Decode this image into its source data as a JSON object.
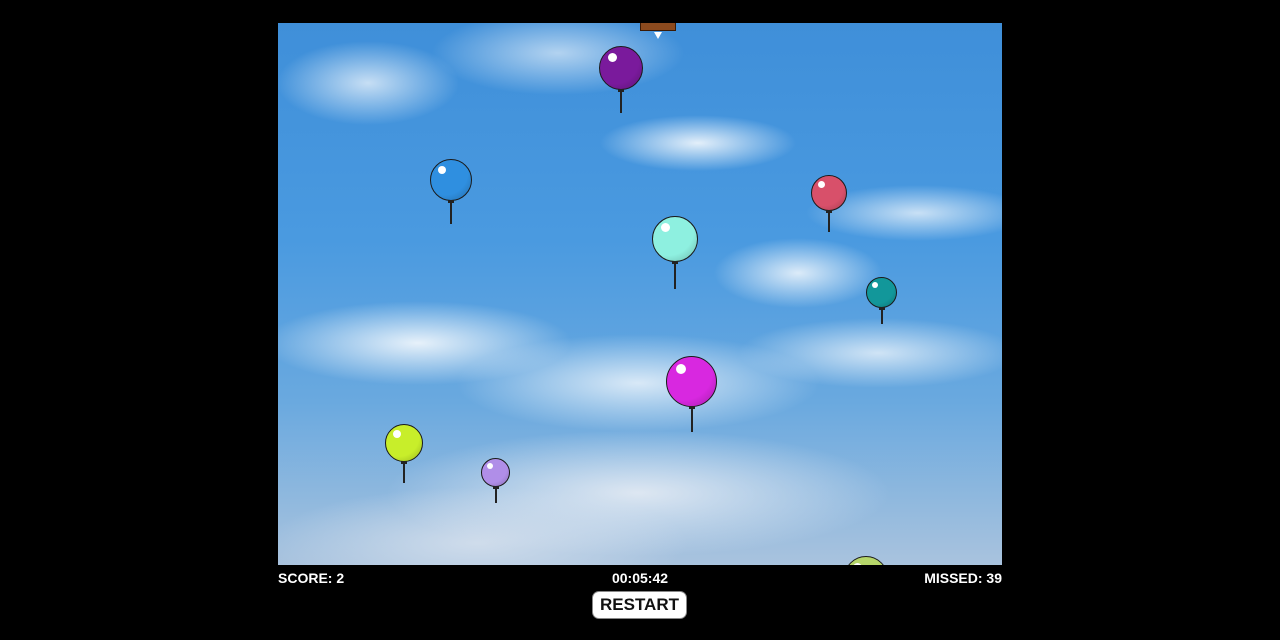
{
  "hud": {
    "score_text": "SCORE: 2",
    "timer_text": "00:05:42",
    "missed_text": "MISSED: 39"
  },
  "controls": {
    "restart_label": "RESTART"
  },
  "balloons": [
    {
      "color": "#7a1a9c",
      "name": "balloon-purple"
    },
    {
      "color": "#2f8fe0",
      "name": "balloon-blue"
    },
    {
      "color": "#d8506a",
      "name": "balloon-red"
    },
    {
      "color": "#8ef0e0",
      "name": "balloon-mint"
    },
    {
      "color": "#12979a",
      "name": "balloon-teal"
    },
    {
      "color": "#d828e0",
      "name": "balloon-magenta"
    },
    {
      "color": "#c8ee2a",
      "name": "balloon-lime"
    },
    {
      "color": "#b08ee8",
      "name": "balloon-lavender"
    },
    {
      "color": "#b6d66a",
      "name": "balloon-olive"
    }
  ]
}
